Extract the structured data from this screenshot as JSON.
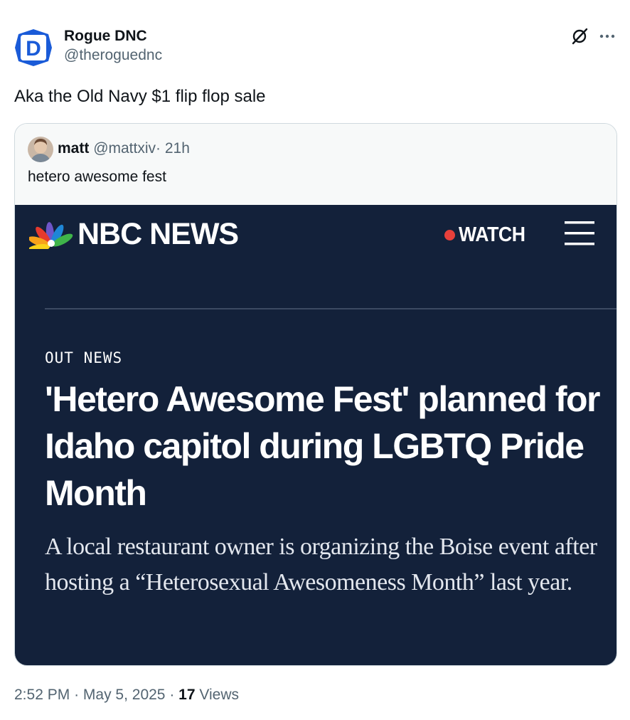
{
  "author": {
    "name": "Rogue DNC",
    "handle": "@theroguednc",
    "avatar_letter": "D",
    "avatar_color": "#1a5bd8"
  },
  "top_actions": {
    "grok_icon": "grok-slash-icon",
    "more_icon": "more-dots-icon"
  },
  "tweet": {
    "text": "Aka the Old Navy $1 flip flop sale"
  },
  "quote": {
    "name": "matt",
    "handle": "@mattxiv",
    "separator": "·",
    "time": "21h",
    "text": "hetero awesome fest",
    "embed": {
      "brand": "NBC NEWS",
      "watch_label": "WATCH",
      "watch_dot_color": "#e8403b",
      "section": "OUT NEWS",
      "headline": "'Hetero Awesome Fest' planned for Idaho capitol during LGBTQ Pride Month",
      "deck": "A local restaurant owner is organizing the Boise event after hosting a “Heterosexual Awesomeness Month” last year.",
      "background": "#13213a"
    }
  },
  "footer": {
    "time": "2:52 PM",
    "sep1": "·",
    "date": "May 5, 2025",
    "sep2": "·",
    "views_count": "17",
    "views_label": "Views"
  }
}
